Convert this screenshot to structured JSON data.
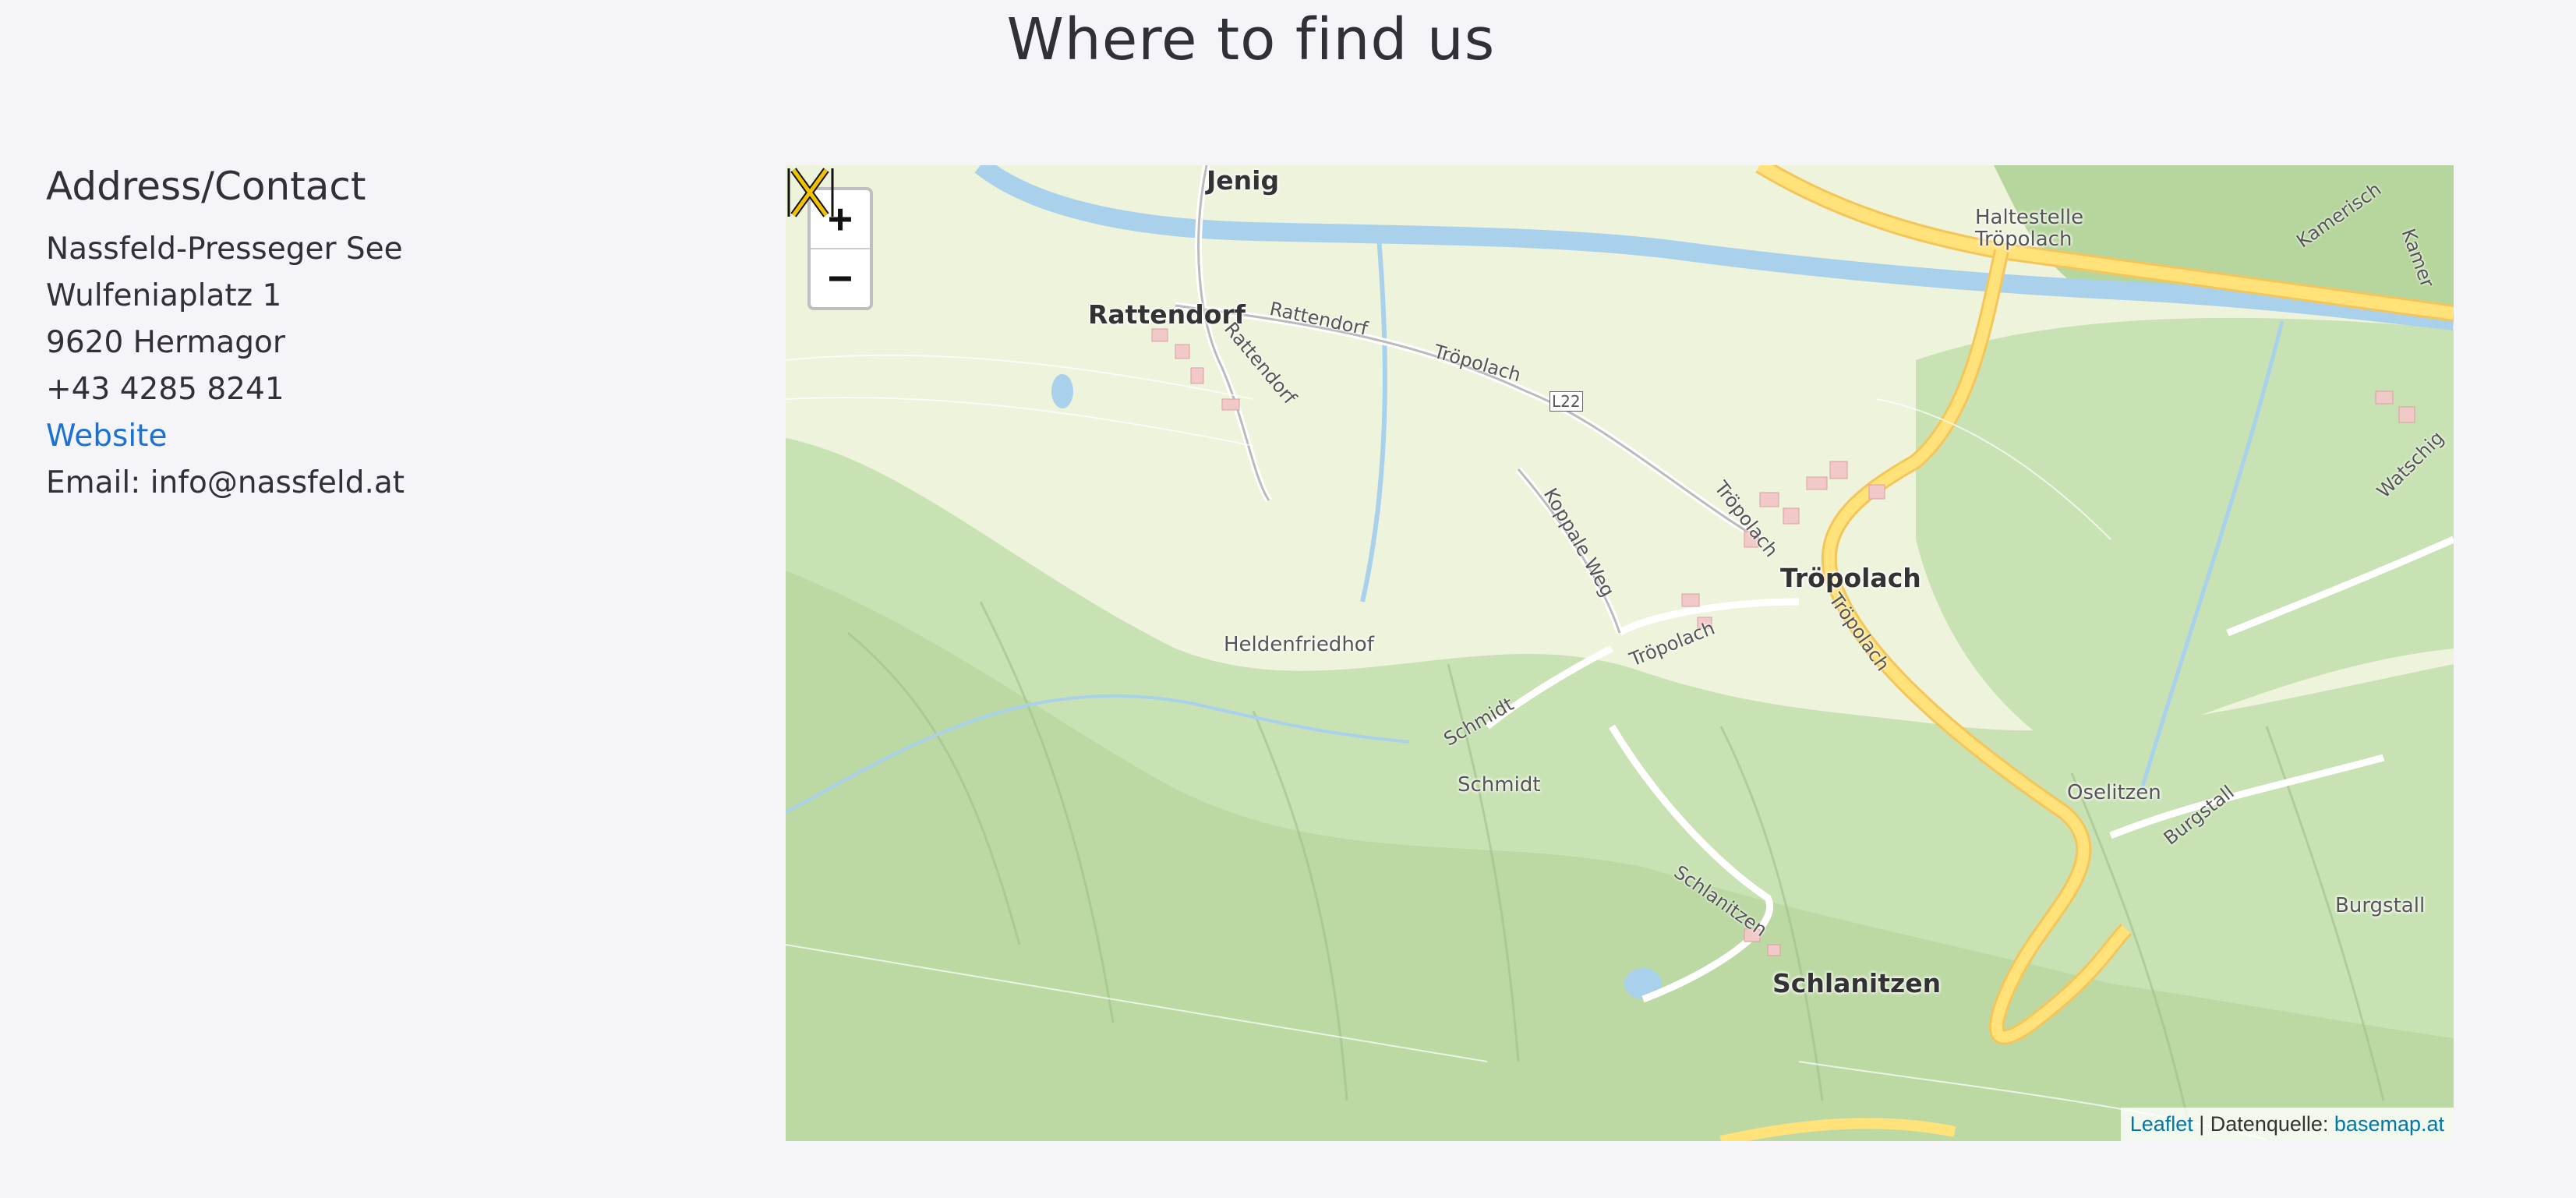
{
  "page": {
    "title": "Where to find us"
  },
  "contact": {
    "heading": "Address/Contact",
    "name": "Nassfeld-Presseger See",
    "street": "Wulfeniaplatz 1",
    "city": "9620 Hermagor",
    "phone": "+43 4285 8241",
    "website_label": "Website",
    "email": "Email: info@nassfeld.at",
    "link_color": "#1a73d4"
  },
  "map": {
    "zoom_in": "+",
    "zoom_out": "−",
    "marker_icon": "ski-marker-icon",
    "places": {
      "jenig": "Jenig",
      "rattendorf": "Rattendorf",
      "rattendorf_road": "Rattendorf",
      "rattendorf_road2": "Rattendorf",
      "tropolach_road": "Tröpolach",
      "l22": "L22",
      "haltestelle": "Haltestelle",
      "haltestelle2": "Tröpolach",
      "koppale_weg": "Koppale Weg",
      "tropolach_road2": "Tröpolach",
      "tropolach": "Tröpolach",
      "tropolach_road3": "Tröpolach",
      "tropolach_road4": "Tröpolach",
      "heldenfriedhof": "Heldenfriedhof",
      "schmidt_road": "Schmidt",
      "schmidt": "Schmidt",
      "oselitzen": "Oselitzen",
      "burgstall_road": "Burgstall",
      "burgstall": "Burgstall",
      "schlanitzen_road": "Schlanitzen",
      "schlanitzen": "Schlanitzen",
      "kamerisch": "Kamerisch",
      "kamer": "Kamer",
      "watschig": "Watschig"
    },
    "attribution": {
      "leaflet": "Leaflet",
      "separator": " | Datenquelle: ",
      "source": "basemap.at"
    },
    "colors": {
      "river": "#a9d1ec",
      "highway": "#ffe27a",
      "forest": "#c9e2b4",
      "land": "#eef3dc"
    }
  }
}
